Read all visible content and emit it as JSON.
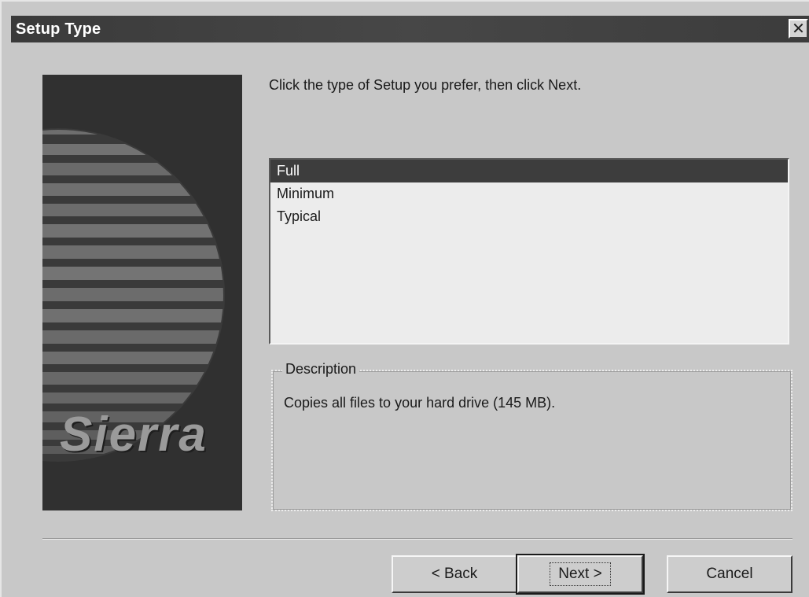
{
  "window": {
    "title": "Setup Type",
    "close_glyph": "✕"
  },
  "banner": {
    "logo_text": "Sierra"
  },
  "prompt": "Click the type of Setup you prefer, then click Next.",
  "setup_list": {
    "items": [
      "Full",
      "Minimum",
      "Typical"
    ],
    "selected": "Full"
  },
  "description": {
    "legend": "Description",
    "text": "Copies all files to your hard drive (145 MB)."
  },
  "buttons": {
    "back": "< Back",
    "next": "Next >",
    "cancel": "Cancel"
  },
  "colors": {
    "titlebar": "#3a3a3a",
    "selection": "#3d3d3d",
    "face": "#c8c8c8"
  }
}
